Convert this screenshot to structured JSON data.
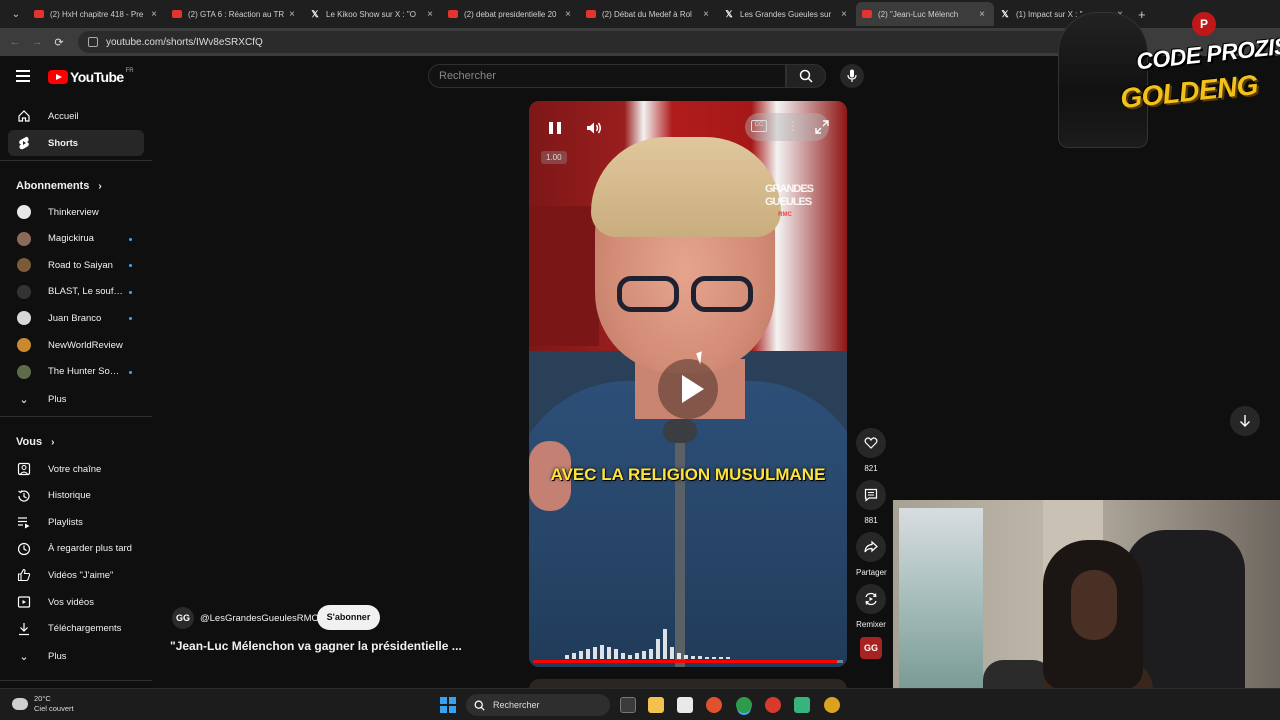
{
  "browser": {
    "tabs": [
      {
        "title": "(2) HxH chapitre 418 - Pre",
        "icon": "youtube-icon"
      },
      {
        "title": "(2) GTA 6 : Réaction au TR",
        "icon": "youtube-icon"
      },
      {
        "title": "Le Kikoo Show sur X : \"O",
        "icon": "x-icon"
      },
      {
        "title": "(2) debat presidentielle 20",
        "icon": "youtube-icon"
      },
      {
        "title": "(2) Débat du Medef à Rol",
        "icon": "youtube-icon"
      },
      {
        "title": "Les Grandes Gueules sur",
        "icon": "x-icon"
      },
      {
        "title": "(2) \"Jean-Luc Mélench",
        "icon": "youtube-icon",
        "active": true
      },
      {
        "title": "(1) Impact sur X : \"",
        "icon": "x-icon"
      }
    ],
    "url": "youtube.com/shorts/IWv8eSRXCfQ"
  },
  "masthead": {
    "logo": "YouTube",
    "country": "FR",
    "search_placeholder": "Rechercher"
  },
  "sidebar": {
    "main": [
      {
        "label": "Accueil",
        "icon": "home-icon"
      },
      {
        "label": "Shorts",
        "icon": "shorts-icon",
        "active": true
      }
    ],
    "subscriptions_title": "Abonnements",
    "subscriptions": [
      {
        "label": "Thinkerview",
        "color": "#e8e8e8",
        "dot": false
      },
      {
        "label": "Magickirua",
        "color": "#8a6b5a",
        "dot": true
      },
      {
        "label": "Road to Saiyan",
        "color": "#7b5a3a",
        "dot": true
      },
      {
        "label": "BLAST, Le souffl...",
        "color": "#333333",
        "dot": true
      },
      {
        "label": "Juan Branco",
        "color": "#d8d8d8",
        "dot": true
      },
      {
        "label": "NewWorldReview",
        "color": "#c98a2e",
        "dot": false
      },
      {
        "label": "The Hunter Soci...",
        "color": "#5e6b4a",
        "dot": true
      }
    ],
    "subs_more": "Plus",
    "you_title": "Vous",
    "you": [
      {
        "label": "Votre chaîne",
        "icon": "channel-icon"
      },
      {
        "label": "Historique",
        "icon": "history-icon"
      },
      {
        "label": "Playlists",
        "icon": "playlist-icon"
      },
      {
        "label": "À regarder plus tard",
        "icon": "clock-icon"
      },
      {
        "label": "Vidéos \"J'aime\"",
        "icon": "thumbs-up-icon"
      },
      {
        "label": "Vos vidéos",
        "icon": "video-icon"
      },
      {
        "label": "Téléchargements",
        "icon": "download-icon"
      }
    ],
    "you_more": "Plus"
  },
  "player": {
    "speed": "1.00",
    "caption": "AVEC LA RELIGION MUSULMANE",
    "watermark_top": "GRANDES GUEULES",
    "watermark_sub": "RMC",
    "progress": 0.98
  },
  "actions": {
    "likes": "821",
    "comments": "881",
    "share": "Partager",
    "remix": "Remixer"
  },
  "short": {
    "channel_handle": "@LesGrandesGueulesRMC",
    "channel_initials": "GG",
    "subscribe": "S'abonner",
    "title": "\"Jean-Luc Mélenchon va gagner la présidentielle ..."
  },
  "overlay": {
    "line1": "CODE PROZIS:",
    "line2": "GOLDENG"
  },
  "taskbar": {
    "temp": "20°C",
    "weather": "Ciel couvert",
    "search": "Rechercher"
  }
}
